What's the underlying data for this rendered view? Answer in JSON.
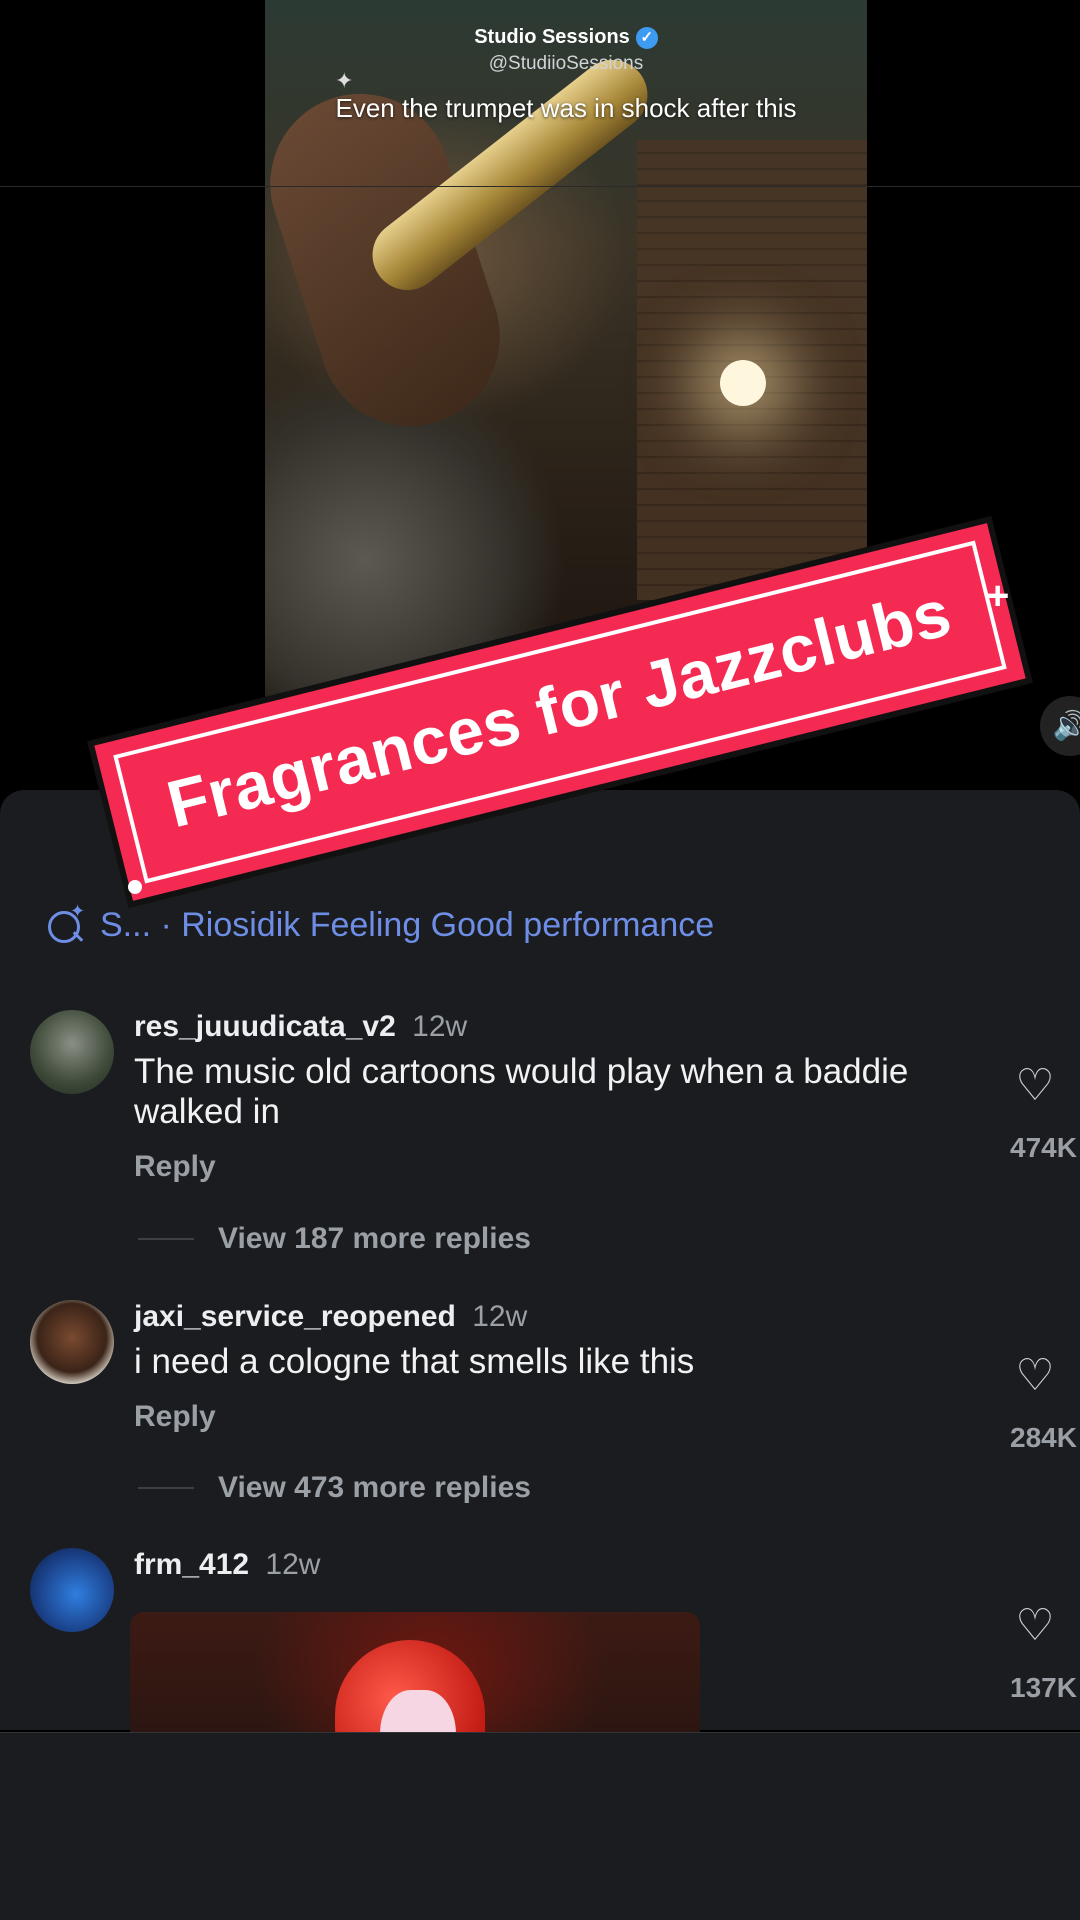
{
  "video": {
    "channel_name": "Studio Sessions",
    "handle": "@StudiioSessions",
    "caption": "Even the trumpet was in shock after this"
  },
  "sticker": {
    "text": "Fragrances for Jazzclubs"
  },
  "search": {
    "text": "S... · Riosidik Feeling Good performance"
  },
  "comments": [
    {
      "user": "res_juuudicata_v2",
      "time": "12w",
      "text": "The music old cartoons would play when a baddie walked in",
      "reply_label": "Reply",
      "more_replies": "View 187 more replies",
      "likes": "474K"
    },
    {
      "user": "jaxi_service_reopened",
      "time": "12w",
      "text": "i need a cologne that smells like this",
      "reply_label": "Reply",
      "more_replies": "View 473 more replies",
      "likes": "284K"
    },
    {
      "user": "frm_412",
      "time": "12w",
      "text": "",
      "likes": "137K"
    }
  ],
  "icons": {
    "verified": "verified-badge-icon",
    "heart": "heart-icon",
    "search": "search-sparkle-icon",
    "volume": "volume-icon"
  },
  "colors": {
    "sticker": "#f52a52",
    "link": "#6e8ee6",
    "sheet": "#1b1c20"
  }
}
